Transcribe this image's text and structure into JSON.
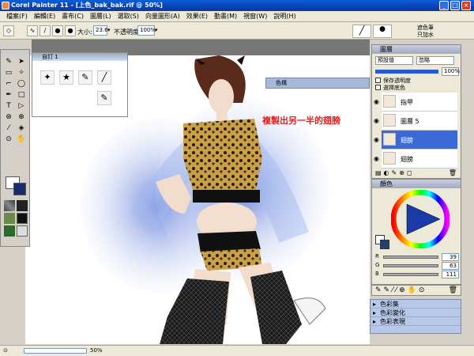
{
  "window": {
    "title": "Corel Painter 11 - [上色_bak_bak.rif @ 50%]"
  },
  "menu": [
    "檔案(F)",
    "編輯(E)",
    "畫布(C)",
    "圖層(L)",
    "選取(S)",
    "向量圖形(A)",
    "效果(E)",
    "動畫(M)",
    "視窗(W)",
    "說明(H)"
  ],
  "propbar": {
    "size_label": "大小:",
    "size_value": "23.6",
    "opacity_label": "不透明度:",
    "opacity_value": "100%",
    "method": "遮色筆",
    "submethod": "只加水"
  },
  "custom_palette": {
    "title": "自訂",
    "index": "1"
  },
  "swatch_panel": {
    "title": "色構"
  },
  "layers": {
    "title": "圖層",
    "composite_method": "預設值",
    "composite_depth": "忽略",
    "opacity": "100%",
    "preserve_transparency": "保存透明度",
    "pick_up_color": "選擇底色",
    "items": [
      {
        "name": "指甲"
      },
      {
        "name": "圖層 5"
      },
      {
        "name": "翅膀"
      },
      {
        "name": "翅膀"
      }
    ]
  },
  "color": {
    "title": "顏色",
    "r": "39",
    "g": "63",
    "b": "111",
    "hex": "#273f6f"
  },
  "collapsed_palettes": [
    "色彩集",
    "色彩變化",
    "色彩表現"
  ],
  "status": {
    "zoom": "50%"
  },
  "annotation": "複製出另一半的翅膀",
  "colors": {
    "titlebar": "#0843b8",
    "annotation": "#e02020",
    "wing": "#8ea8e8"
  }
}
